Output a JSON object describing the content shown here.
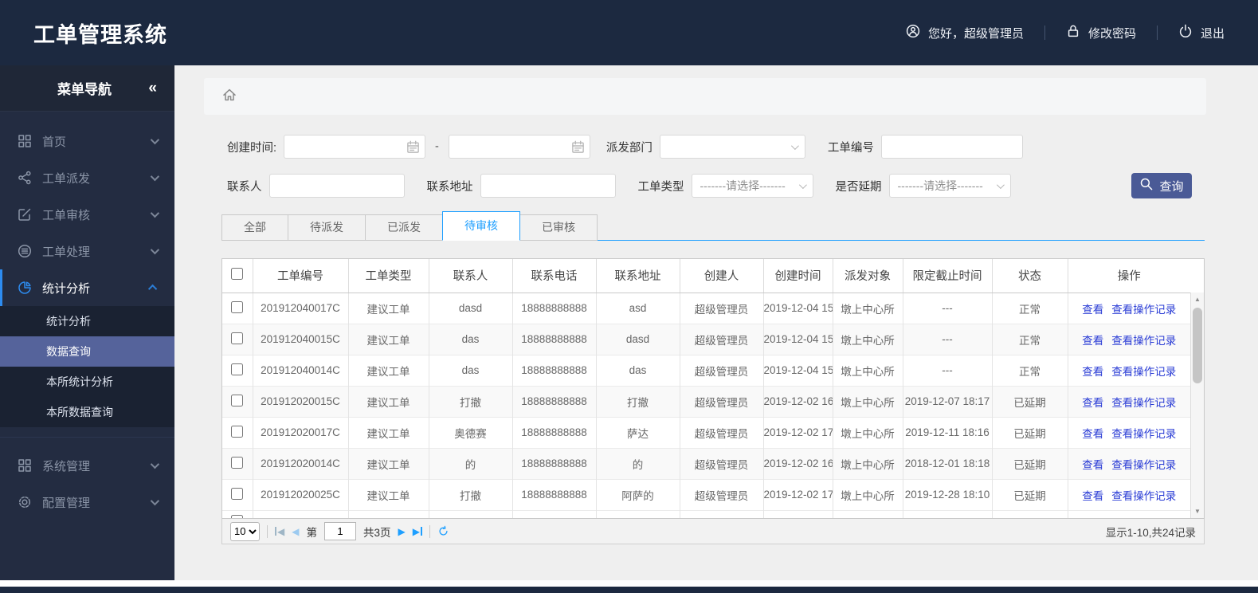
{
  "header": {
    "title": "工单管理系统",
    "greeting": "您好，超级管理员",
    "change_password": "修改密码",
    "logout": "退出"
  },
  "sidebar": {
    "title": "菜单导航",
    "collapse_icon": "«",
    "items": [
      {
        "key": "home",
        "label": "首页",
        "icon": "grid-icon"
      },
      {
        "key": "order-dispatch",
        "label": "工单派发",
        "icon": "share-icon"
      },
      {
        "key": "order-review",
        "label": "工单审核",
        "icon": "edit-icon"
      },
      {
        "key": "order-process",
        "label": "工单处理",
        "icon": "process-icon"
      },
      {
        "key": "stats-analysis",
        "label": "统计分析",
        "icon": "pie-icon",
        "active": true,
        "expanded": true,
        "children": [
          {
            "key": "stats-analysis-sub",
            "label": "统计分析"
          },
          {
            "key": "data-query",
            "label": "数据查询",
            "active": true
          },
          {
            "key": "branch-stats",
            "label": "本所统计分析"
          },
          {
            "key": "branch-data-query",
            "label": "本所数据查询"
          }
        ]
      },
      {
        "key": "system-mgmt",
        "label": "系统管理",
        "icon": "grid-icon",
        "divider_before": true
      },
      {
        "key": "config-mgmt",
        "label": "配置管理",
        "icon": "gear-icon"
      }
    ]
  },
  "filters": {
    "create_time": {
      "label": "创建时间:",
      "value": "",
      "separator": "-"
    },
    "dispatch_dept": {
      "label": "派发部门",
      "value": ""
    },
    "order_no": {
      "label": "工单编号",
      "value": ""
    },
    "contact": {
      "label": "联系人",
      "value": ""
    },
    "address": {
      "label": "联系地址",
      "value": ""
    },
    "order_type": {
      "label": "工单类型",
      "value": "-------请选择-------"
    },
    "is_delayed": {
      "label": "是否延期",
      "value": "-------请选择-------"
    },
    "search_label": "查询"
  },
  "tabs": [
    {
      "key": "all",
      "label": "全部"
    },
    {
      "key": "pending-dispatch",
      "label": "待派发"
    },
    {
      "key": "dispatched",
      "label": "已派发"
    },
    {
      "key": "pending-review",
      "label": "待审核",
      "active": true
    },
    {
      "key": "reviewed",
      "label": "已审核"
    }
  ],
  "table": {
    "columns": [
      {
        "key": "order-no",
        "label": "工单编号"
      },
      {
        "key": "order-type",
        "label": "工单类型"
      },
      {
        "key": "contact",
        "label": "联系人"
      },
      {
        "key": "phone",
        "label": "联系电话"
      },
      {
        "key": "address",
        "label": "联系地址"
      },
      {
        "key": "creator",
        "label": "创建人"
      },
      {
        "key": "created-time",
        "label": "创建时间"
      },
      {
        "key": "dispatch-target",
        "label": "派发对象"
      },
      {
        "key": "deadline",
        "label": "限定截止时间"
      },
      {
        "key": "status",
        "label": "状态"
      },
      {
        "key": "actions",
        "label": "操作"
      }
    ],
    "action_labels": {
      "view": "查看",
      "view_log": "查看操作记录"
    },
    "rows": [
      {
        "id": "201912040017C",
        "type": "建议工单",
        "contact": "dasd",
        "phone": "18888888888",
        "address": "asd",
        "creator": "超级管理员",
        "created": "2019-12-04 15",
        "target": "墩上中心所",
        "deadline": "---",
        "status": "正常",
        "status_type": "normal"
      },
      {
        "id": "201912040015C",
        "type": "建议工单",
        "contact": "das",
        "phone": "18888888888",
        "address": "dasd",
        "creator": "超级管理员",
        "created": "2019-12-04 15",
        "target": "墩上中心所",
        "deadline": "---",
        "status": "正常",
        "status_type": "normal"
      },
      {
        "id": "201912040014C",
        "type": "建议工单",
        "contact": "das",
        "phone": "18888888888",
        "address": "das",
        "creator": "超级管理员",
        "created": "2019-12-04 15",
        "target": "墩上中心所",
        "deadline": "---",
        "status": "正常",
        "status_type": "normal"
      },
      {
        "id": "201912020015C",
        "type": "建议工单",
        "contact": "打撤",
        "phone": "18888888888",
        "address": "打撤",
        "creator": "超级管理员",
        "created": "2019-12-02 16",
        "target": "墩上中心所",
        "deadline": "2019-12-07 18:17",
        "status": "已延期",
        "status_type": "delayed"
      },
      {
        "id": "201912020017C",
        "type": "建议工单",
        "contact": "奥德赛",
        "phone": "18888888888",
        "address": "萨达",
        "creator": "超级管理员",
        "created": "2019-12-02 17",
        "target": "墩上中心所",
        "deadline": "2019-12-11 18:16",
        "status": "已延期",
        "status_type": "delayed"
      },
      {
        "id": "201912020014C",
        "type": "建议工单",
        "contact": "的",
        "phone": "18888888888",
        "address": "的",
        "creator": "超级管理员",
        "created": "2019-12-02 16",
        "target": "墩上中心所",
        "deadline": "2018-12-01 18:18",
        "status": "已延期",
        "status_type": "delayed"
      },
      {
        "id": "201912020025C",
        "type": "建议工单",
        "contact": "打撤",
        "phone": "18888888888",
        "address": "阿萨的",
        "creator": "超级管理员",
        "created": "2019-12-02 17",
        "target": "墩上中心所",
        "deadline": "2019-12-28 18:10",
        "status": "已延期",
        "status_type": "delayed"
      }
    ]
  },
  "pagination": {
    "page_size": "10",
    "page_prefix": "第",
    "current_page": "1",
    "total_pages": "共3页",
    "summary": "显示1-10,共24记录"
  }
}
